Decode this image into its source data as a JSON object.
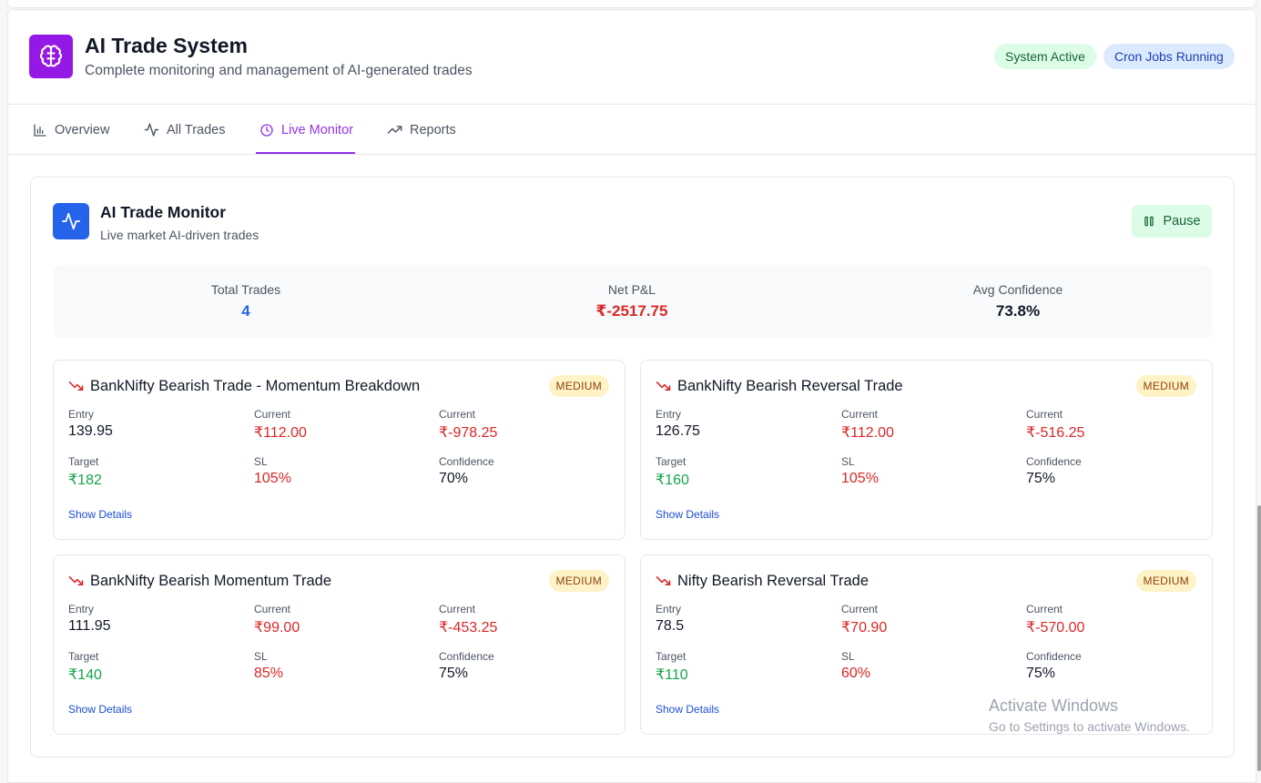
{
  "header": {
    "title": "AI Trade System",
    "subtitle": "Complete monitoring and management of AI-generated trades",
    "badges": [
      "System Active",
      "Cron Jobs Running"
    ]
  },
  "tabs": [
    {
      "label": "Overview",
      "icon": "bar-chart-icon"
    },
    {
      "label": "All Trades",
      "icon": "activity-icon"
    },
    {
      "label": "Live Monitor",
      "icon": "clock-icon",
      "active": true
    },
    {
      "label": "Reports",
      "icon": "trending-up-icon"
    }
  ],
  "monitor": {
    "title": "AI Trade Monitor",
    "subtitle": "Live market AI-driven trades",
    "pause_label": "Pause",
    "stats": [
      {
        "label": "Total Trades",
        "value": "4",
        "color": "#2563eb"
      },
      {
        "label": "Net P&L",
        "value": "₹-2517.75",
        "color": "#dc2626"
      },
      {
        "label": "Avg Confidence",
        "value": "73.8%",
        "color": "#111827"
      }
    ]
  },
  "trades": [
    {
      "title": "BankNifty Bearish Trade - Momentum Breakdown",
      "risk": "MEDIUM",
      "entry_label": "Entry",
      "entry": "139.95",
      "current_label": "Current",
      "current": "₹112.00",
      "pnl_label": "Current",
      "pnl": "₹-978.25",
      "target_label": "Target",
      "target": "₹182",
      "sl_label": "SL",
      "sl": "105%",
      "confidence_label": "Confidence",
      "confidence": "70%",
      "details_label": "Show Details"
    },
    {
      "title": "BankNifty Bearish Reversal Trade",
      "risk": "MEDIUM",
      "entry_label": "Entry",
      "entry": "126.75",
      "current_label": "Current",
      "current": "₹112.00",
      "pnl_label": "Current",
      "pnl": "₹-516.25",
      "target_label": "Target",
      "target": "₹160",
      "sl_label": "SL",
      "sl": "105%",
      "confidence_label": "Confidence",
      "confidence": "75%",
      "details_label": "Show Details"
    },
    {
      "title": "BankNifty Bearish Momentum Trade",
      "risk": "MEDIUM",
      "entry_label": "Entry",
      "entry": "111.95",
      "current_label": "Current",
      "current": "₹99.00",
      "pnl_label": "Current",
      "pnl": "₹-453.25",
      "target_label": "Target",
      "target": "₹140",
      "sl_label": "SL",
      "sl": "85%",
      "confidence_label": "Confidence",
      "confidence": "75%",
      "details_label": "Show Details"
    },
    {
      "title": "Nifty Bearish Reversal Trade",
      "risk": "MEDIUM",
      "entry_label": "Entry",
      "entry": "78.5",
      "current_label": "Current",
      "current": "₹70.90",
      "pnl_label": "Current",
      "pnl": "₹-570.00",
      "target_label": "Target",
      "target": "₹110",
      "sl_label": "SL",
      "sl": "60%",
      "confidence_label": "Confidence",
      "confidence": "75%",
      "details_label": "Show Details"
    }
  ],
  "watermark": {
    "title": "Activate Windows",
    "subtitle": "Go to Settings to activate Windows."
  }
}
